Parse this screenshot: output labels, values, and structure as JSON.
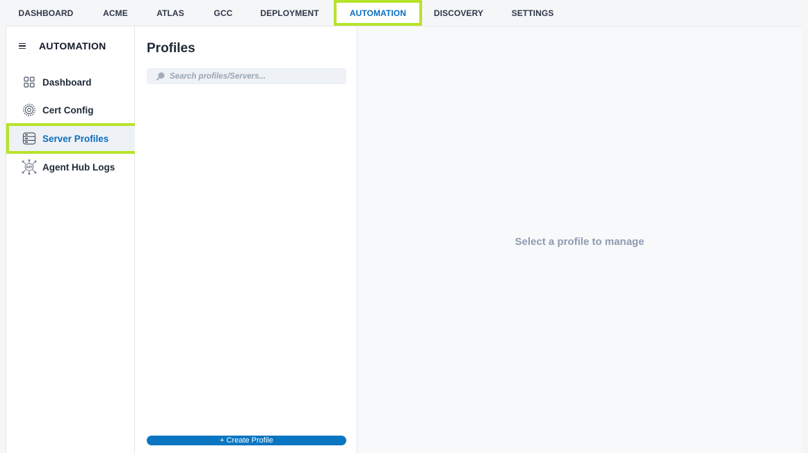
{
  "topnav": {
    "tabs": [
      {
        "label": "DASHBOARD"
      },
      {
        "label": "ACME"
      },
      {
        "label": "ATLAS"
      },
      {
        "label": "GCC"
      },
      {
        "label": "DEPLOYMENT"
      },
      {
        "label": "AUTOMATION",
        "active": true
      },
      {
        "label": "DISCOVERY"
      },
      {
        "label": "SETTINGS"
      }
    ]
  },
  "sidebar": {
    "menu_icon": "hamburger-menu-icon",
    "title": "AUTOMATION",
    "items": [
      {
        "label": "Dashboard",
        "icon": "dashboard-grid-icon"
      },
      {
        "label": "Cert Config",
        "icon": "gear-badge-icon"
      },
      {
        "label": "Server Profiles",
        "icon": "server-icon",
        "active": true
      },
      {
        "label": "Agent Hub Logs",
        "icon": "api-network-icon"
      }
    ]
  },
  "profiles": {
    "title": "Profiles",
    "search": {
      "placeholder": "Search profiles/Servers...",
      "value": "",
      "icon": "search-icon"
    },
    "create_button": "+ Create Profile"
  },
  "detail": {
    "empty_message": "Select a profile to manage"
  },
  "colors": {
    "accent": "#0a6ebd",
    "highlight": "#b7e32a",
    "button": "#0a76c2",
    "muted_text": "#8f9bb0"
  }
}
